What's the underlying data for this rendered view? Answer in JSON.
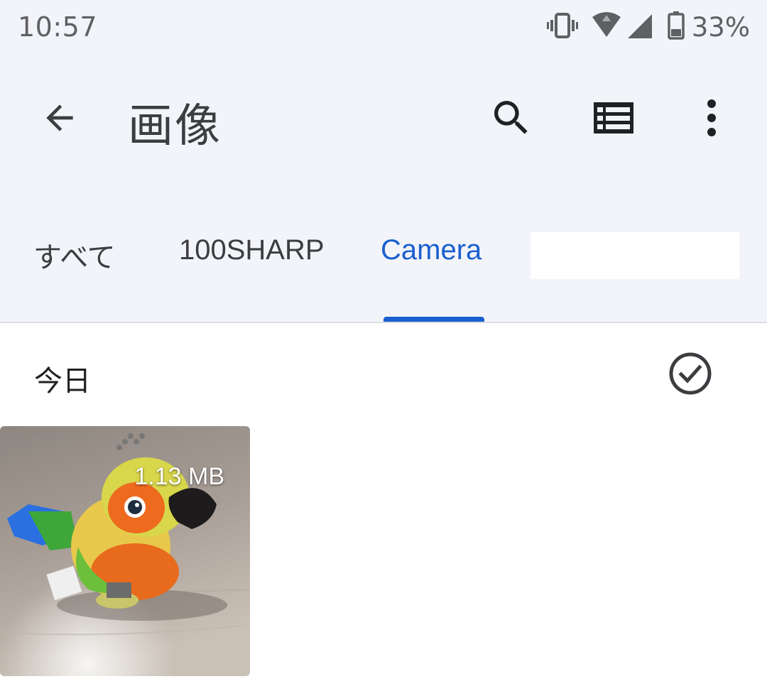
{
  "status_bar": {
    "time": "10:57",
    "battery_percent": "33%",
    "icons": [
      "vibrate-icon",
      "wifi-icon",
      "signal-icon",
      "battery-icon"
    ]
  },
  "app_bar": {
    "title": "画像",
    "icons": [
      "back-arrow-icon",
      "search-icon",
      "list-view-icon",
      "more-vert-icon"
    ]
  },
  "tabs": [
    {
      "label": "すべて",
      "active": false
    },
    {
      "label": "100SHARP",
      "active": false
    },
    {
      "label": "Camera",
      "active": true
    }
  ],
  "section": {
    "title": "今日",
    "select_icon": "check-circle-icon"
  },
  "items": [
    {
      "size": "1.13 MB",
      "thumbnail": "parakeet-plush-photo"
    }
  ],
  "colors": {
    "accent": "#1a5fcf",
    "header_bg": "#f3f4f9",
    "text_primary": "#202124",
    "text_secondary": "#5f6063"
  }
}
